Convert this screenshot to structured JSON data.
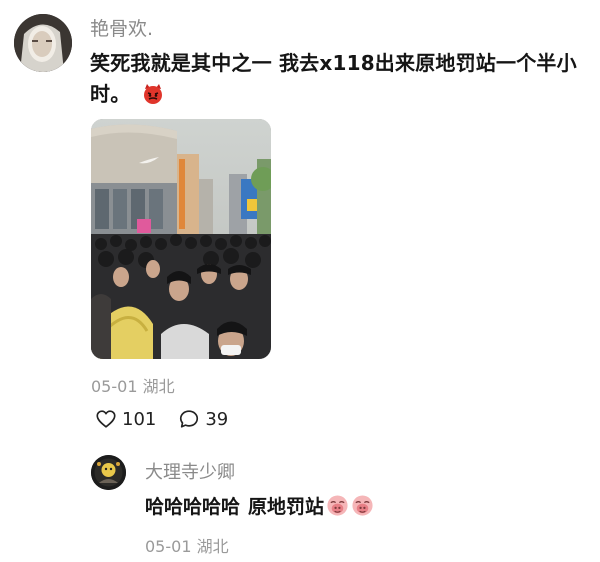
{
  "comment": {
    "username": "艳骨欢.",
    "text": "笑死我就是其中之一 我去x118出来原地罚站一个半小时。",
    "emoji": "devil-face-emoji",
    "photo": "crowd-photo",
    "date": "05-01",
    "location": "湖北",
    "likes": "101",
    "replies": "39"
  },
  "reply": {
    "username": "大理寺少卿",
    "text_part1": "哈哈哈哈哈",
    "text_part2": "原地罚站",
    "emoji": "pig-face-emoji",
    "date": "05-01",
    "location": "湖北"
  },
  "colors": {
    "meta": "#9a9a9a",
    "username": "#8a8a8a",
    "text": "#151515"
  }
}
